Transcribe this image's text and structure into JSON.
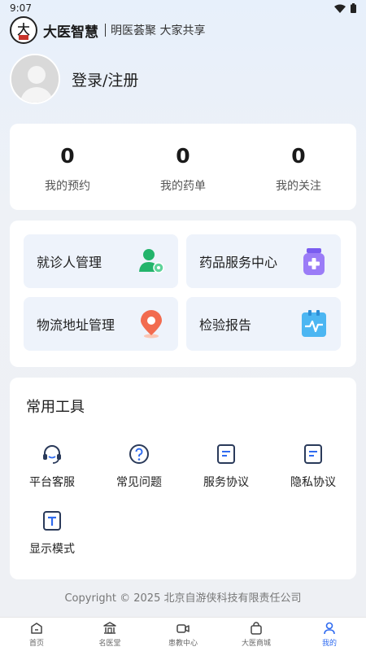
{
  "status_bar": {
    "time": "9:07"
  },
  "brand": {
    "name": "大医智慧",
    "slogan": "明医荟聚 大家共享",
    "logo_char": "大"
  },
  "profile": {
    "login_label": "登录/注册"
  },
  "stats": [
    {
      "value": "0",
      "label": "我的预约"
    },
    {
      "value": "0",
      "label": "我的药单"
    },
    {
      "value": "0",
      "label": "我的关注"
    }
  ],
  "services": [
    {
      "label": "就诊人管理",
      "icon": "patient-manage-icon"
    },
    {
      "label": "药品服务中心",
      "icon": "medicine-bottle-icon"
    },
    {
      "label": "物流地址管理",
      "icon": "location-pin-icon"
    },
    {
      "label": "检验报告",
      "icon": "report-chart-icon"
    }
  ],
  "tools": {
    "title": "常用工具",
    "items": [
      {
        "label": "平台客服",
        "icon": "headset-icon"
      },
      {
        "label": "常见问题",
        "icon": "question-icon"
      },
      {
        "label": "服务协议",
        "icon": "document-icon"
      },
      {
        "label": "隐私协议",
        "icon": "document-icon"
      },
      {
        "label": "显示模式",
        "icon": "text-mode-icon"
      }
    ]
  },
  "copyright": "Copyright © 2025 北京自游侠科技有限责任公司",
  "tabbar": [
    {
      "label": "首页",
      "icon": "home-icon"
    },
    {
      "label": "名医堂",
      "icon": "hall-icon"
    },
    {
      "label": "患教中心",
      "icon": "video-icon"
    },
    {
      "label": "大医商城",
      "icon": "shopping-bag-icon"
    },
    {
      "label": "我的",
      "icon": "user-icon",
      "active": true
    }
  ],
  "colors": {
    "accent": "#2f6bf0",
    "card_bg": "#ffffff",
    "tile_bg": "#eef3fb"
  }
}
